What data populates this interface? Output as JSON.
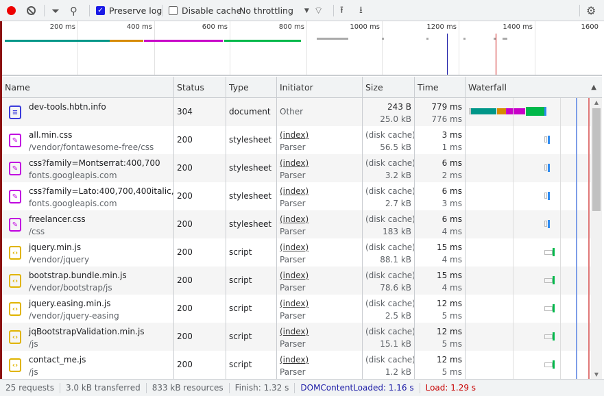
{
  "toolbar": {
    "preserve_log": "Preserve log",
    "preserve_log_checked": true,
    "disable_cache": "Disable cache",
    "disable_cache_checked": false,
    "throttling": "No throttling"
  },
  "overview": {
    "ticks": [
      "200 ms",
      "400 ms",
      "600 ms",
      "800 ms",
      "1000 ms",
      "1200 ms",
      "1400 ms",
      "1600"
    ]
  },
  "columns": [
    "Name",
    "Status",
    "Type",
    "Initiator",
    "Size",
    "Time",
    "Waterfall"
  ],
  "rows": [
    {
      "name": "dev-tools.hbtn.info",
      "path": "",
      "status": "304",
      "type": "document",
      "initiator": "Other",
      "initiator_sub": "",
      "size": "243 B",
      "size_sub": "25.0 kB",
      "time": "779 ms",
      "time_sub": "776 ms",
      "icon": "document-icon"
    },
    {
      "name": "all.min.css",
      "path": "/vendor/fontawesome-free/css",
      "status": "200",
      "type": "stylesheet",
      "initiator": "(index)",
      "initiator_sub": "Parser",
      "size": "(disk cache)",
      "size_sub": "56.5 kB",
      "time": "3 ms",
      "time_sub": "1 ms",
      "icon": "stylesheet-icon"
    },
    {
      "name": "css?family=Montserrat:400,700",
      "path": "fonts.googleapis.com",
      "status": "200",
      "type": "stylesheet",
      "initiator": "(index)",
      "initiator_sub": "Parser",
      "size": "(disk cache)",
      "size_sub": "3.2 kB",
      "time": "6 ms",
      "time_sub": "2 ms",
      "icon": "stylesheet-icon"
    },
    {
      "name": "css?family=Lato:400,700,400italic,7…",
      "path": "fonts.googleapis.com",
      "status": "200",
      "type": "stylesheet",
      "initiator": "(index)",
      "initiator_sub": "Parser",
      "size": "(disk cache)",
      "size_sub": "2.7 kB",
      "time": "6 ms",
      "time_sub": "3 ms",
      "icon": "stylesheet-icon"
    },
    {
      "name": "freelancer.css",
      "path": "/css",
      "status": "200",
      "type": "stylesheet",
      "initiator": "(index)",
      "initiator_sub": "Parser",
      "size": "(disk cache)",
      "size_sub": "183 kB",
      "time": "6 ms",
      "time_sub": "4 ms",
      "icon": "stylesheet-icon"
    },
    {
      "name": "jquery.min.js",
      "path": "/vendor/jquery",
      "status": "200",
      "type": "script",
      "initiator": "(index)",
      "initiator_sub": "Parser",
      "size": "(disk cache)",
      "size_sub": "88.1 kB",
      "time": "15 ms",
      "time_sub": "4 ms",
      "icon": "script-icon"
    },
    {
      "name": "bootstrap.bundle.min.js",
      "path": "/vendor/bootstrap/js",
      "status": "200",
      "type": "script",
      "initiator": "(index)",
      "initiator_sub": "Parser",
      "size": "(disk cache)",
      "size_sub": "78.6 kB",
      "time": "15 ms",
      "time_sub": "4 ms",
      "icon": "script-icon"
    },
    {
      "name": "jquery.easing.min.js",
      "path": "/vendor/jquery-easing",
      "status": "200",
      "type": "script",
      "initiator": "(index)",
      "initiator_sub": "Parser",
      "size": "(disk cache)",
      "size_sub": "2.5 kB",
      "time": "12 ms",
      "time_sub": "5 ms",
      "icon": "script-icon"
    },
    {
      "name": "jqBootstrapValidation.min.js",
      "path": "/js",
      "status": "200",
      "type": "script",
      "initiator": "(index)",
      "initiator_sub": "Parser",
      "size": "(disk cache)",
      "size_sub": "15.1 kB",
      "time": "12 ms",
      "time_sub": "5 ms",
      "icon": "script-icon"
    },
    {
      "name": "contact_me.js",
      "path": "/js",
      "status": "200",
      "type": "script",
      "initiator": "(index)",
      "initiator_sub": "Parser",
      "size": "(disk cache)",
      "size_sub": "1.2 kB",
      "time": "12 ms",
      "time_sub": "5 ms",
      "icon": "script-icon"
    }
  ],
  "status": {
    "requests": "25 requests",
    "transferred": "3.0 kB transferred",
    "resources": "833 kB resources",
    "finish": "Finish: 1.32 s",
    "dcl": "DOMContentLoaded: 1.16 s",
    "load": "Load: 1.29 s"
  },
  "colors": {
    "dcl": "#1a1aa6",
    "load": "#c80000",
    "teal": "#009688",
    "orange": "#d68a00",
    "magenta": "#c800c8",
    "green": "#00b84a",
    "blue": "#2e8bf0"
  }
}
